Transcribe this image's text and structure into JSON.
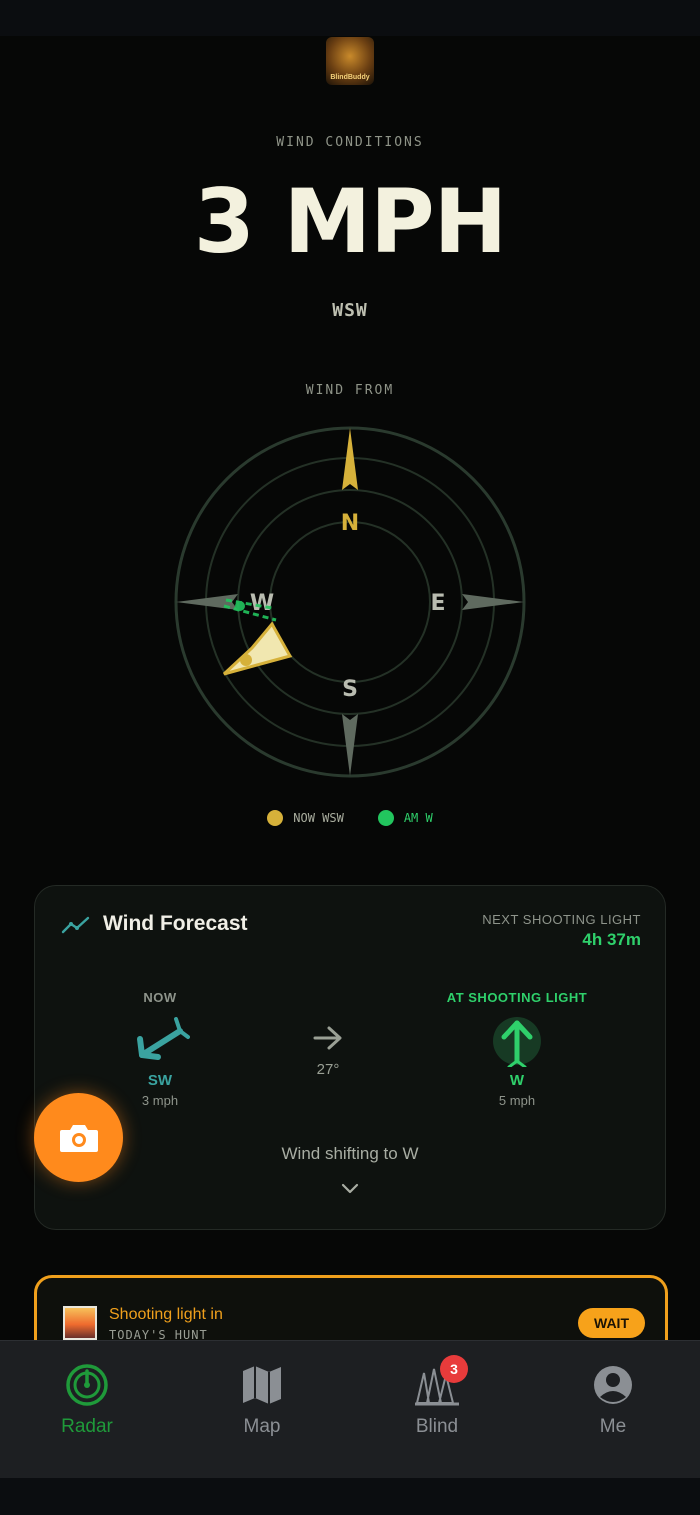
{
  "header": {
    "logo_text": "BlindBuddy"
  },
  "wind": {
    "section_label": "WIND CONDITIONS",
    "speed": "3 MPH",
    "direction": "WSW",
    "compass_label": "WIND FROM",
    "compass_dirs": {
      "n": "N",
      "e": "E",
      "s": "S",
      "w": "W"
    },
    "legend": [
      {
        "label": "NOW WSW",
        "color": "#d6b13a"
      },
      {
        "label": "AM W",
        "color": "#22c55e"
      }
    ]
  },
  "forecast": {
    "title": "Wind Forecast",
    "next_label": "NEXT SHOOTING LIGHT",
    "next_value": "4h 37m",
    "now": {
      "head": "NOW",
      "dir": "SW",
      "speed": "3 mph"
    },
    "shift": {
      "degrees": "27°"
    },
    "at_light": {
      "head": "AT SHOOTING LIGHT",
      "dir": "W",
      "speed": "5 mph"
    },
    "shift_text": "Wind shifting to W"
  },
  "hunt": {
    "title": "Shooting light in",
    "subtitle": "TODAY'S HUNT",
    "button": "WAIT"
  },
  "tabs": [
    {
      "label": "Radar",
      "icon": "radar-icon",
      "active": true
    },
    {
      "label": "Map",
      "icon": "map-icon"
    },
    {
      "label": "Blind",
      "icon": "blind-icon",
      "badge": "3"
    },
    {
      "label": "Me",
      "icon": "user-icon"
    }
  ],
  "colors": {
    "accent_green": "#2fd06b",
    "accent_orange": "#ff8a1c",
    "gold": "#d6b13a",
    "teal": "#3aa3a0"
  }
}
